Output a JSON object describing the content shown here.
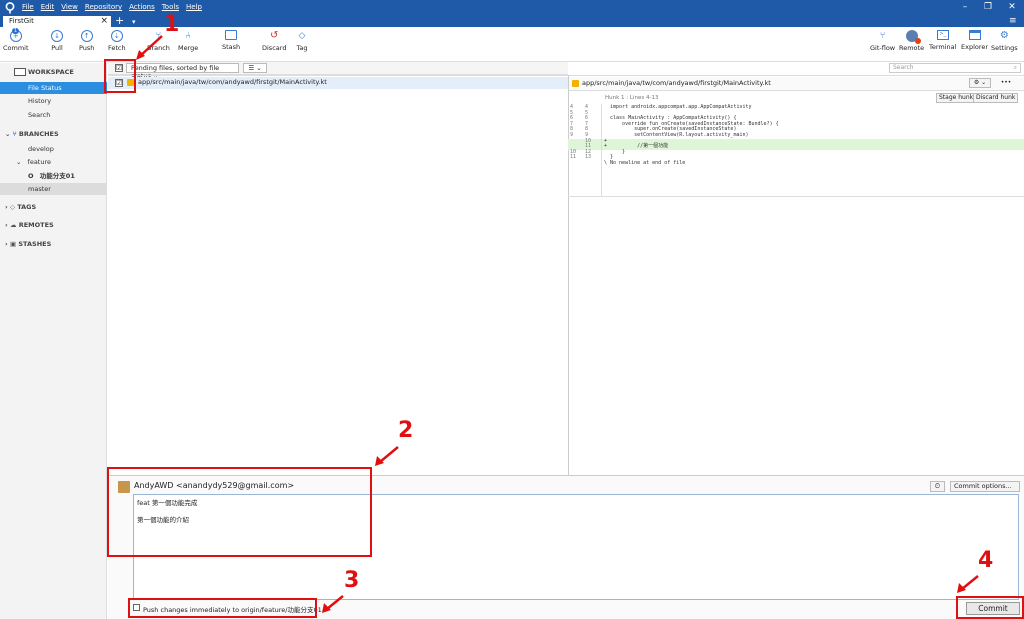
{
  "app": {
    "tab_title": "FirstGit",
    "tab_close": "×",
    "tab_add": "+",
    "tab_menu": "▾",
    "hamburger": "≡"
  },
  "window": {
    "minimize": "–",
    "maximize": "❐",
    "close": "✕"
  },
  "menu": [
    "File",
    "Edit",
    "View",
    "Repository",
    "Actions",
    "Tools",
    "Help"
  ],
  "toolbar": {
    "left": [
      {
        "label": "Commit",
        "badge": "1"
      },
      {
        "label": "Pull"
      },
      {
        "label": "Push"
      },
      {
        "label": "Fetch"
      },
      {
        "label": "Branch"
      },
      {
        "label": "Merge"
      },
      {
        "label": "Stash"
      },
      {
        "label": "Discard"
      },
      {
        "label": "Tag"
      }
    ],
    "right": [
      {
        "label": "Git-flow"
      },
      {
        "label": "Remote"
      },
      {
        "label": "Terminal"
      },
      {
        "label": "Explorer"
      },
      {
        "label": "Settings"
      }
    ]
  },
  "sidebar": {
    "workspace": "WORKSPACE",
    "file_status": "File Status",
    "history": "History",
    "search": "Search",
    "branches": "BRANCHES",
    "develop": "develop",
    "feature": "feature",
    "feature_branch": "功能分支01",
    "current_marker": "O",
    "master": "master",
    "tags": "TAGS",
    "remotes": "REMOTES",
    "stashes": "STASHES"
  },
  "files": {
    "sort_label": "Pending files, sorted by file status ⌄",
    "view_label": "☰ ⌄",
    "search_placeholder": "Search",
    "check_mark": "☑",
    "row_path": "app/src/main/java/tw/com/andyawd/firstgit/MainActivity.kt"
  },
  "diff": {
    "file_path": "app/src/main/java/tw/com/andyawd/firstgit/MainActivity.kt",
    "hunk_label": "Hunk 1 : Lines 4-13",
    "stage_hunk": "Stage hunk",
    "discard_hunk": "Discard hunk",
    "gear": "⚙ ⌄",
    "more": "•••",
    "lines": [
      {
        "o": "4",
        "n": "4",
        "t": "  import androidx.appcompat.app.AppCompatActivity",
        "add": false
      },
      {
        "o": "5",
        "n": "5",
        "t": "",
        "add": false
      },
      {
        "o": "6",
        "n": "6",
        "t": "  class MainActivity : AppCompatActivity() {",
        "add": false
      },
      {
        "o": "7",
        "n": "7",
        "t": "      override fun onCreate(savedInstanceState: Bundle?) {",
        "add": false
      },
      {
        "o": "8",
        "n": "8",
        "t": "          super.onCreate(savedInstanceState)",
        "add": false
      },
      {
        "o": "9",
        "n": "9",
        "t": "          setContentView(R.layout.activity_main)",
        "add": false
      },
      {
        "o": "",
        "n": "10",
        "t": "+",
        "add": true
      },
      {
        "o": "",
        "n": "11",
        "t": "+          //第一個功能",
        "add": true
      },
      {
        "o": "10",
        "n": "12",
        "t": "      }",
        "add": false
      },
      {
        "o": "11",
        "n": "13",
        "t": "  }",
        "add": false
      },
      {
        "o": "",
        "n": "",
        "t": "\\ No newline at end of file",
        "add": false
      }
    ]
  },
  "commit": {
    "author": "AndyAWD <anandydy529@gmail.com>",
    "message_line1": "feat 第一個功能完成",
    "message_line2": "第一個功能的介紹",
    "history_icon": "⏲",
    "options": "Commit options... ⌄",
    "push_label": "Push changes immediately to origin/feature/功能分支01",
    "commit_button": "Commit"
  },
  "annotations": {
    "n1": "1",
    "n2": "2",
    "n3": "3",
    "n4": "4",
    "color": "#e01010"
  }
}
